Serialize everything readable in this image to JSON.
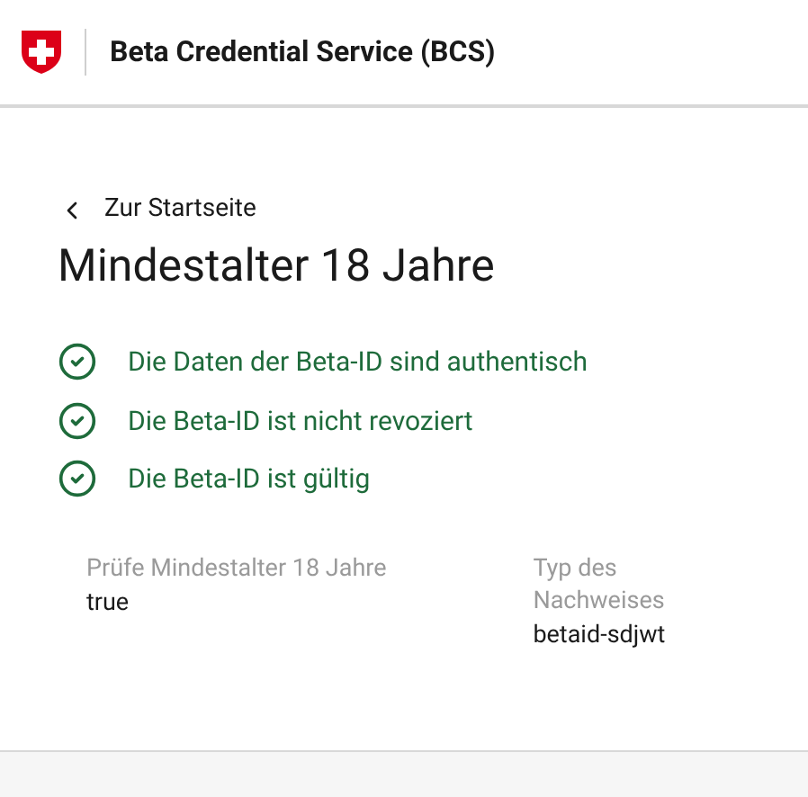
{
  "header": {
    "title": "Beta Credential Service (BCS)"
  },
  "back_link": {
    "label": "Zur Startseite"
  },
  "heading": "Mindestalter 18 Jahre",
  "checks": [
    {
      "label": "Die Daten der Beta-ID sind authentisch",
      "passed": true
    },
    {
      "label": "Die Beta-ID ist nicht revoziert",
      "passed": true
    },
    {
      "label": "Die Beta-ID ist gültig",
      "passed": true
    }
  ],
  "fields": [
    {
      "label": "Prüfe Mindestalter 18 Jahre",
      "value": "true"
    },
    {
      "label": "Typ des Nachweises",
      "value": "betaid-sdjwt"
    }
  ]
}
